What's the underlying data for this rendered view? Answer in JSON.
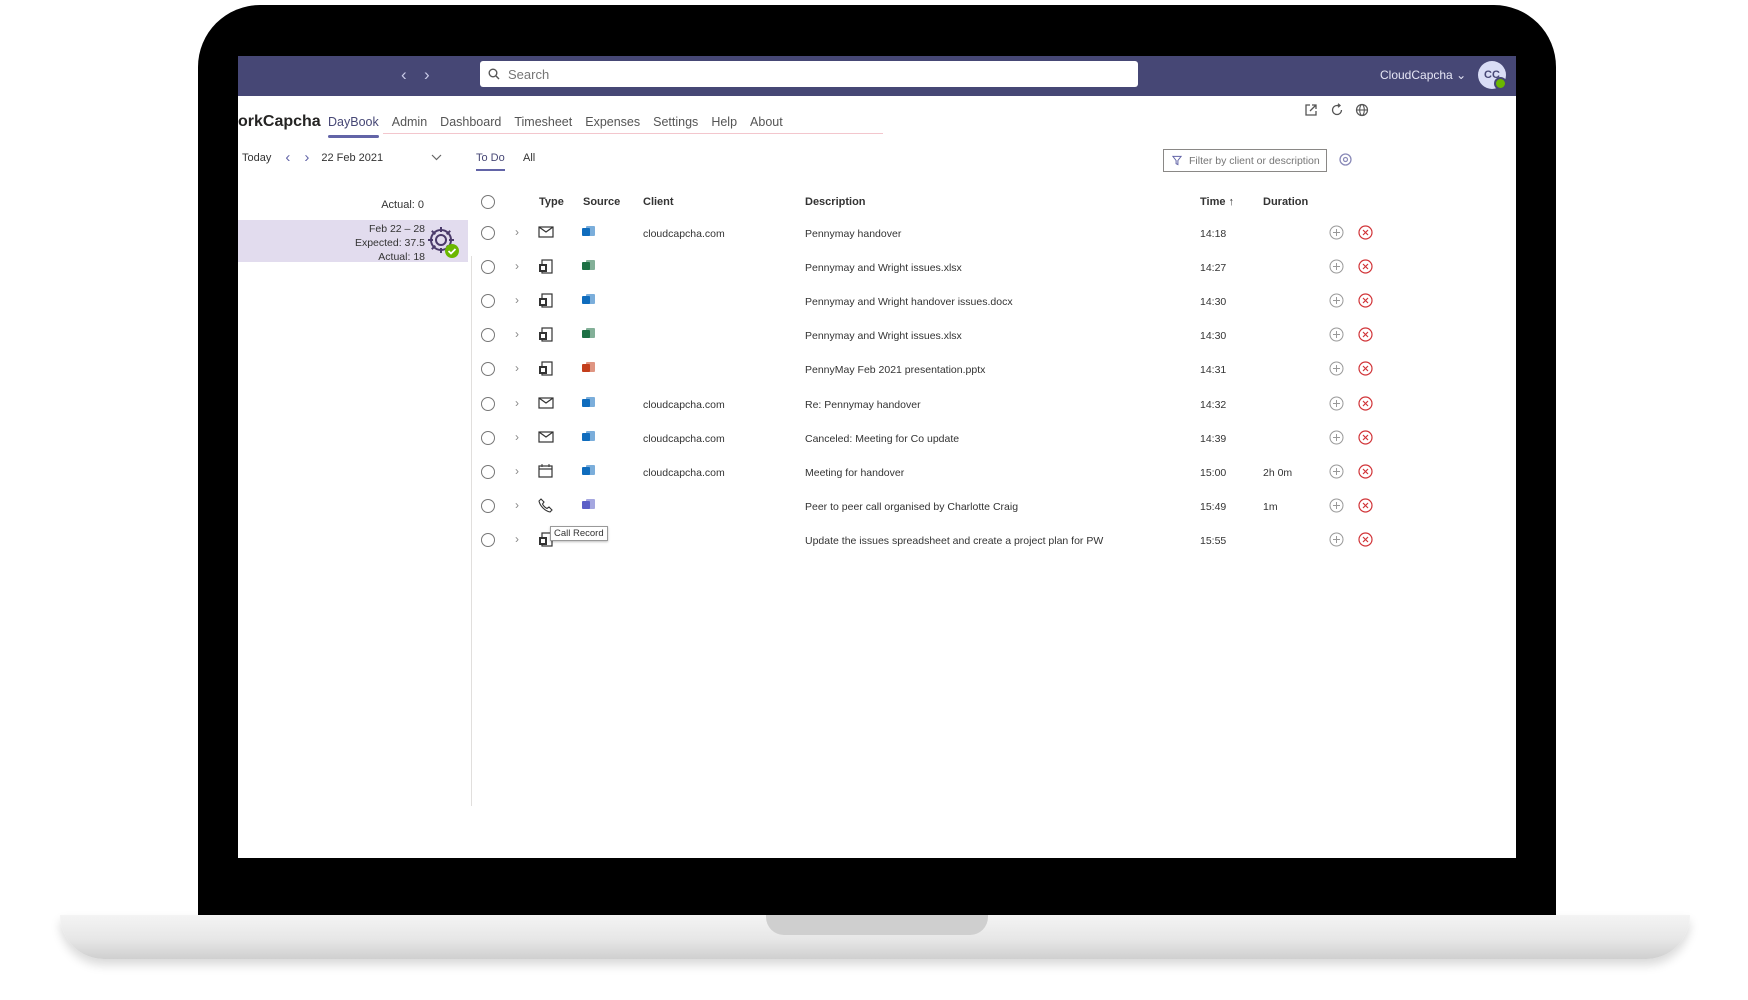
{
  "topbar": {
    "search_placeholder": "Search",
    "org_name": "CloudCapcha",
    "org_chevron": "⌄",
    "avatar_initials": "CC"
  },
  "app": {
    "title": "orkCapcha",
    "tabs": [
      {
        "label": "DayBook",
        "active": true
      },
      {
        "label": "Admin"
      },
      {
        "label": "Dashboard"
      },
      {
        "label": "Timesheet"
      },
      {
        "label": "Expenses"
      },
      {
        "label": "Settings"
      },
      {
        "label": "Help"
      },
      {
        "label": "About"
      }
    ],
    "right_icons": [
      "open-external-icon",
      "refresh-icon",
      "globe-icon"
    ]
  },
  "left_panel": {
    "today_label": "Today",
    "date": "22 Feb 2021",
    "actual_label": "Actual: 0",
    "week": {
      "range": "Feb 22 – 28",
      "expected": "Expected: 37.5",
      "actual": "Actual: 18"
    }
  },
  "main": {
    "tabs": [
      {
        "label": "To Do",
        "active": true
      },
      {
        "label": "All"
      }
    ],
    "filter_placeholder": "Filter by client or description",
    "columns": {
      "type": "Type",
      "source": "Source",
      "client": "Client",
      "description": "Description",
      "time": "Time ↑",
      "duration": "Duration"
    },
    "rows": [
      {
        "type": "email",
        "source": "outlook",
        "client": "cloudcapcha.com",
        "description": "Pennymay handover",
        "time": "14:18",
        "duration": ""
      },
      {
        "type": "document",
        "source": "excel",
        "client": "",
        "description": "Pennymay and Wright issues.xlsx",
        "time": "14:27",
        "duration": ""
      },
      {
        "type": "document",
        "source": "outlook",
        "client": "",
        "description": "Pennymay and Wright handover issues.docx",
        "time": "14:30",
        "duration": ""
      },
      {
        "type": "document",
        "source": "excel",
        "client": "",
        "description": "Pennymay and Wright issues.xlsx",
        "time": "14:30",
        "duration": ""
      },
      {
        "type": "document",
        "source": "powerpoint",
        "client": "",
        "description": "PennyMay Feb 2021 presentation.pptx",
        "time": "14:31",
        "duration": ""
      },
      {
        "type": "email",
        "source": "outlook",
        "client": "cloudcapcha.com",
        "description": "Re: Pennymay handover",
        "time": "14:32",
        "duration": ""
      },
      {
        "type": "email",
        "source": "outlook",
        "client": "cloudcapcha.com",
        "description": "Canceled: Meeting for Co update",
        "time": "14:39",
        "duration": ""
      },
      {
        "type": "calendar",
        "source": "outlook",
        "client": "cloudcapcha.com",
        "description": "Meeting for handover",
        "time": "15:00",
        "duration": "2h 0m"
      },
      {
        "type": "phone",
        "source": "teams",
        "client": "",
        "description": "Peer to peer call organised by Charlotte Craig",
        "time": "15:49",
        "duration": "1m"
      },
      {
        "type": "document",
        "source": "",
        "client": "",
        "description": "Update the issues spreadsheet and create a project plan for PW",
        "time": "15:55",
        "duration": ""
      }
    ],
    "tooltip": "Call Record"
  },
  "colors": {
    "topbar": "#464775",
    "accent": "#6264a7",
    "week_card": "#e2dcee",
    "outlook": "#0f6cbd",
    "excel": "#1d7044",
    "powerpoint": "#c43e1c",
    "teams": "#5b5fc7",
    "delete": "#d13438"
  }
}
